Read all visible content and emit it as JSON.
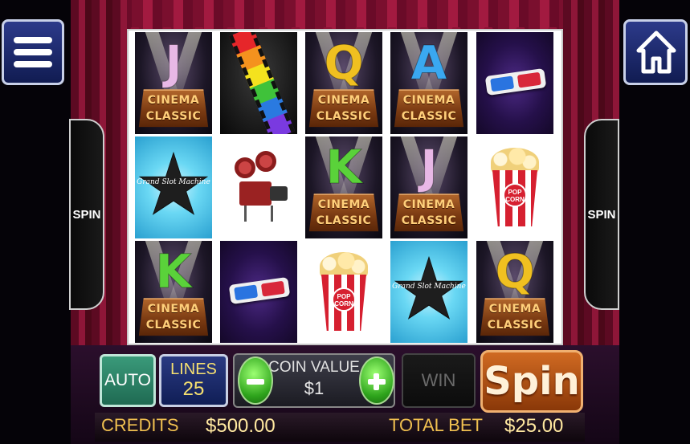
{
  "game": {
    "reels": [
      [
        "cinema-J",
        "film-reel",
        "cinema-Q",
        "cinema-A",
        "3d-glasses"
      ],
      [
        "star",
        "projector",
        "cinema-K",
        "cinema-J",
        "popcorn"
      ],
      [
        "cinema-K",
        "3d-glasses",
        "popcorn",
        "star",
        "cinema-Q"
      ]
    ],
    "cinema_text_1": "CINEMA",
    "cinema_text_2": "CLASSIC",
    "star_text": "Grand Slot Machine",
    "popcorn_text": "POP CORN",
    "letters": {
      "J": "J",
      "Q": "Q",
      "A": "A",
      "K": "K"
    }
  },
  "side": {
    "spin_left": "SPIN",
    "spin_right": "SPIN"
  },
  "controls": {
    "auto_label": "AUTO",
    "lines_label": "LINES",
    "lines_value": "25",
    "coin_label": "COIN VALUE",
    "coin_value": "$1",
    "win_label": "WIN",
    "spin_label": "Spin",
    "credits_label": "CREDITS",
    "credits_value": "$500.00",
    "total_bet_label": "TOTAL BET",
    "total_bet_value": "$25.00"
  },
  "icons": {
    "menu": "menu-icon",
    "home": "home-icon",
    "minus": "minus-icon",
    "plus": "plus-icon"
  },
  "colors": {
    "auto": "#2f8a6c",
    "lines": "#1c2a6c",
    "spin": "#b4561a",
    "label_gold": "#f0c050"
  }
}
